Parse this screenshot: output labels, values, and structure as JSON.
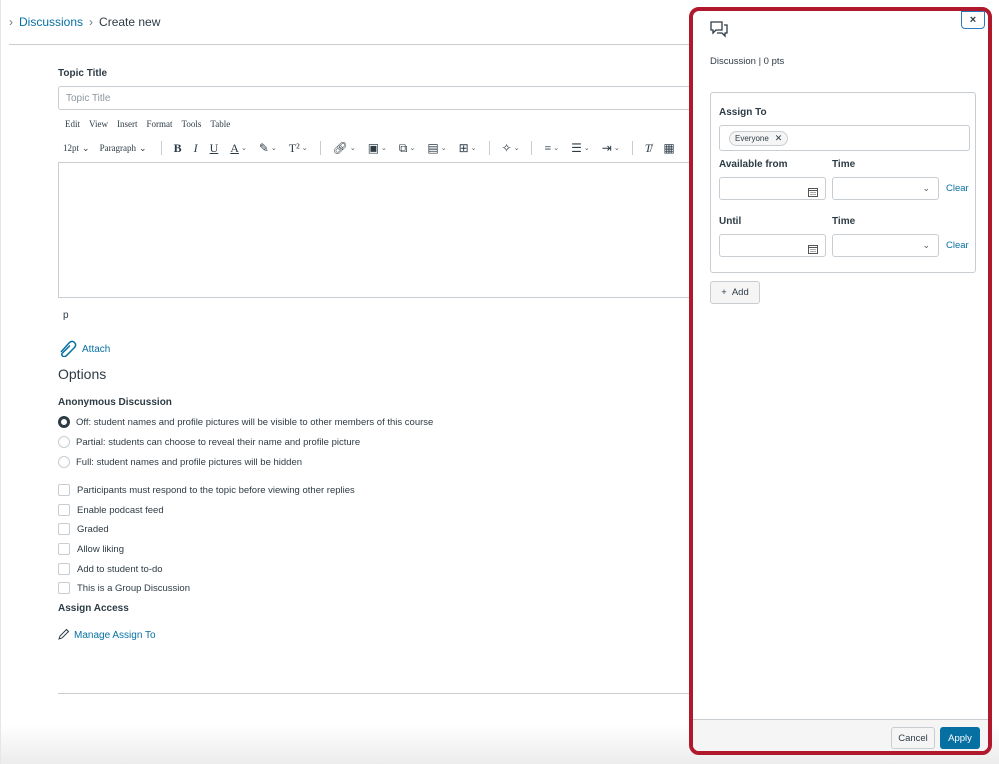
{
  "breadcrumb": {
    "root": "Discussions",
    "current": "Create new"
  },
  "form": {
    "topic_title_label": "Topic Title",
    "topic_title_placeholder": "Topic Title",
    "menubar": [
      "Edit",
      "View",
      "Insert",
      "Format",
      "Tools",
      "Table"
    ],
    "font_size": "12pt",
    "block_format": "Paragraph",
    "path_indicator": "p",
    "attach_label": "Attach",
    "options_heading": "Options",
    "anonymous_label": "Anonymous Discussion",
    "anonymous_options": [
      "Off: student names and profile pictures will be visible to other members of this course",
      "Partial: students can choose to reveal their name and profile picture",
      "Full: student names and profile pictures will be hidden"
    ],
    "checkboxes": [
      "Participants must respond to the topic before viewing other replies",
      "Enable podcast feed",
      "Graded",
      "Allow liking",
      "Add to student to-do",
      "This is a Group Discussion"
    ],
    "assign_access_label": "Assign Access",
    "manage_assign_to": "Manage Assign To"
  },
  "tray": {
    "close_glyph": "×",
    "subtitle": "Discussion | 0 pts",
    "assign_to_label": "Assign To",
    "assignee_pill": "Everyone",
    "available_from_label": "Available from",
    "time_label": "Time",
    "until_label": "Until",
    "clear_label": "Clear",
    "add_label": "Add",
    "cancel_label": "Cancel",
    "apply_label": "Apply"
  },
  "colors": {
    "link": "#0770a3",
    "highlight_border": "#b0182b",
    "text": "#2d3b45"
  }
}
